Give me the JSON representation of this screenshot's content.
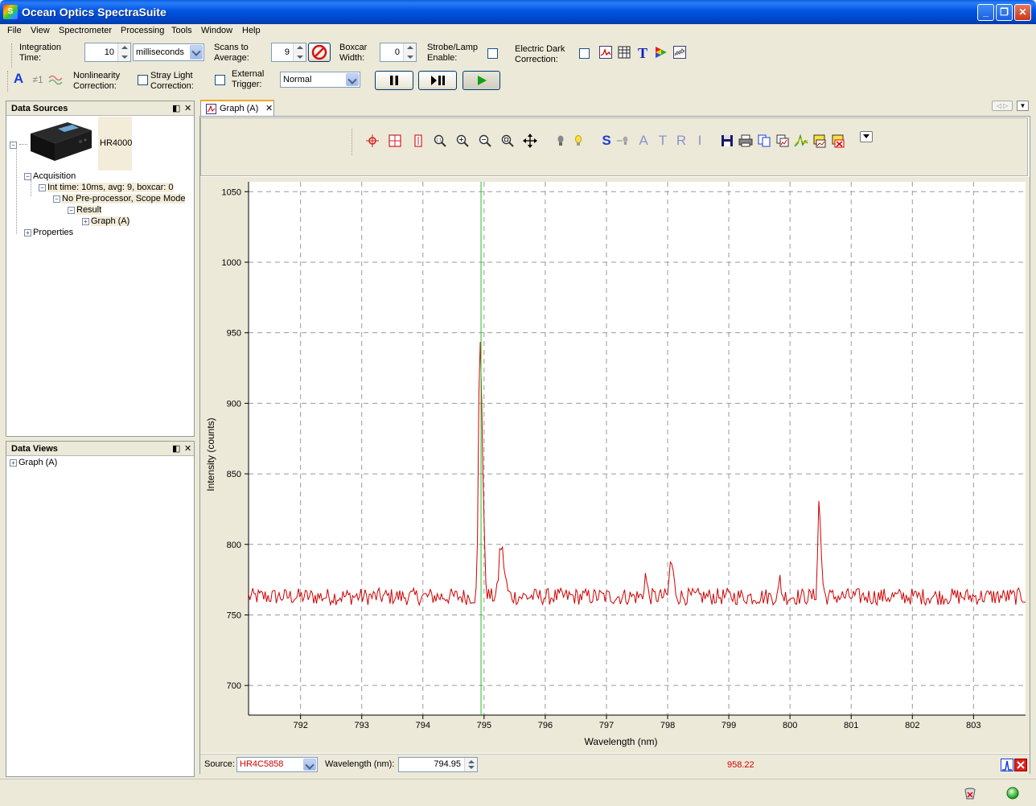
{
  "window": {
    "title": "Ocean Optics SpectraSuite"
  },
  "menu": [
    "File",
    "View",
    "Spectrometer",
    "Processing",
    "Tools",
    "Window",
    "Help"
  ],
  "toolbar": {
    "integration_time_label": [
      "Integration",
      "Time:"
    ],
    "integration_time_value": "10",
    "integration_unit": "milliseconds",
    "scans_label": [
      "Scans to",
      "Average:"
    ],
    "scans_value": "9",
    "boxcar_label": [
      "Boxcar",
      "Width:"
    ],
    "boxcar_value": "0",
    "strobe_label": [
      "Strobe/Lamp",
      "Enable:"
    ],
    "dark_label": [
      "Electric Dark",
      "Correction:"
    ],
    "nonlinearity_label": [
      "Nonlinearity",
      "Correction:"
    ],
    "stray_label": [
      "Stray Light",
      "Correction:"
    ],
    "trigger_label": [
      "External",
      "Trigger:"
    ],
    "trigger_mode": "Normal",
    "a_glyph": "A",
    "ne1_glyph": "≠1"
  },
  "data_sources": {
    "title": "Data Sources",
    "device": "HR4000",
    "acquisition": "Acquisition",
    "int_time": "Int time: 10ms, avg: 9, boxcar: 0",
    "preprocessor": "No Pre-processor, Scope Mode",
    "result": "Result",
    "graph": "Graph (A)",
    "properties": "Properties"
  },
  "data_views": {
    "title": "Data Views",
    "graph": "Graph (A)"
  },
  "graph_tab": {
    "label": "Graph (A)"
  },
  "graph_toolbar": {
    "letters": [
      "S",
      "A",
      "T",
      "R",
      "I"
    ]
  },
  "status": {
    "source_label": "Source:",
    "source_value": "HR4C5858",
    "wavelength_label": "Wavelength (nm):",
    "wavelength_value": "794.95",
    "intensity_readout": "958.22"
  },
  "chart_data": {
    "type": "line",
    "xlabel": "Wavelength (nm)",
    "ylabel": "Intensity (counts)",
    "xlim": [
      791.15,
      803.85
    ],
    "ylim": [
      679,
      1057
    ],
    "x_ticks": [
      792,
      793,
      794,
      795,
      796,
      797,
      798,
      799,
      800,
      801,
      802,
      803
    ],
    "y_ticks": [
      700,
      750,
      800,
      850,
      900,
      950,
      1000,
      1050
    ],
    "grid": true,
    "cursor_x": 794.95,
    "baseline": 763,
    "peaks": [
      {
        "x": 794.93,
        "y": 948,
        "width": 0.06
      },
      {
        "x": 795.27,
        "y": 799,
        "width": 0.08
      },
      {
        "x": 797.63,
        "y": 779,
        "width": 0.04
      },
      {
        "x": 798.05,
        "y": 788,
        "width": 0.06
      },
      {
        "x": 799.83,
        "y": 777,
        "width": 0.03
      },
      {
        "x": 800.47,
        "y": 829,
        "width": 0.05
      }
    ],
    "noise_amplitude": 6,
    "line_color": "#d00000",
    "cursor_color": "#20c020"
  }
}
